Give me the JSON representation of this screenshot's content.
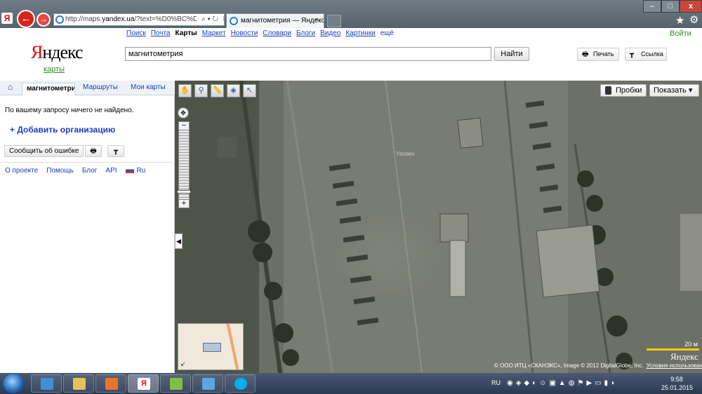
{
  "browser": {
    "url_prefix": "http://maps.",
    "url_host": "yandex.ua",
    "url_rest": "/?text=%D0%BC%D0%B0%D0%B",
    "tab_title": "магнитометрия — Яндекс...",
    "tab_close": "×",
    "back_glyph": "←",
    "forward_glyph": "→",
    "favicon_letter": "Я",
    "window_min": "–",
    "window_max": "□",
    "window_close": "x",
    "favorites_icon": "star-icon",
    "tools_icon": "gear-icon"
  },
  "header": {
    "nav": [
      "Поиск",
      "Почта",
      "Карты",
      "Маркет",
      "Новости",
      "Словари",
      "Блоги",
      "Видео",
      "Картинки"
    ],
    "nav_more": "ещё",
    "login": "Войти",
    "logo_first": "Я",
    "logo_rest": "ндекс",
    "service": "карты",
    "search_value": "магнитометрия",
    "search_button": "Найти",
    "print_button": "Печать",
    "link_button": "Ссылка"
  },
  "sidebar": {
    "tabs": {
      "active": "магнитометрия",
      "routes": "Маршруты",
      "my_maps": "Мои карты"
    },
    "not_found": "По вашему запросу ничего не найдено.",
    "add_org": "+ Добавить организацию",
    "report_error": "Сообщить об ошибке",
    "footer_links": [
      "О проекте",
      "Помощь",
      "Блог",
      "API"
    ],
    "lang": "Ru"
  },
  "map": {
    "traffic_button": "Пробки",
    "show_button": "Показать ▾",
    "tools": [
      "hand-icon",
      "magnifier-icon",
      "ruler-icon",
      "layers-icon",
      "pointer-icon"
    ],
    "watermark": "Yandex",
    "scale_label": "20 м",
    "logo": "Яндекс",
    "copyright": "© ООО ИТЦ «СКАНЭКС», Image © 2012 DigitalGlobe, Inc.",
    "terms": "Условия использования"
  },
  "taskbar": {
    "lang": "RU",
    "time": "9:58",
    "date": "25.01.2015",
    "apps": [
      "outlook",
      "explorer",
      "media-player",
      "yandex-browser",
      "file-app",
      "audio",
      "skype"
    ]
  }
}
